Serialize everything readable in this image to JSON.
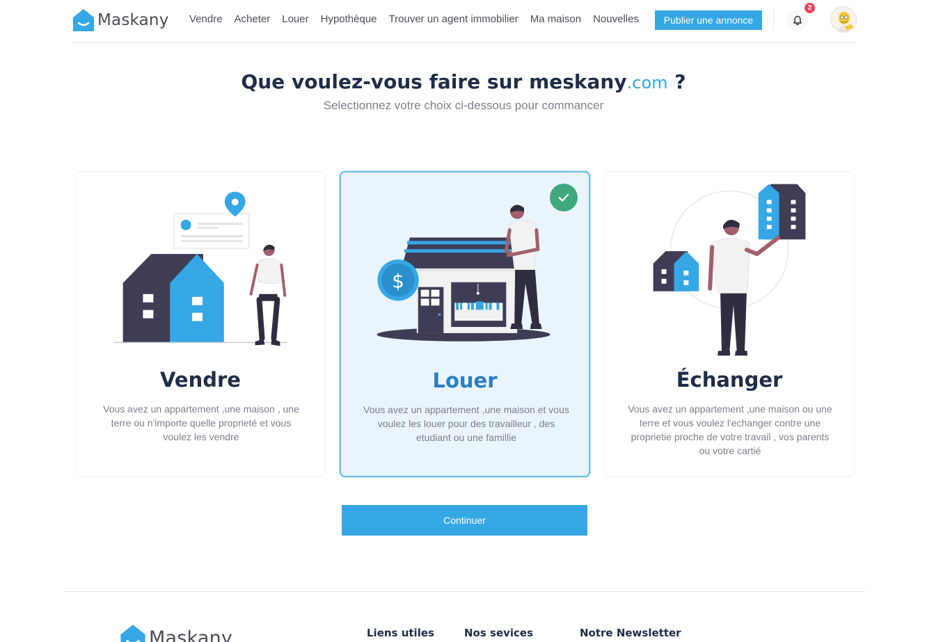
{
  "brand": {
    "name": "Maskany"
  },
  "nav": {
    "links": [
      "Vendre",
      "Acheter",
      "Louer",
      "Hypothèque",
      "Trouver un agent immobilier",
      "Ma maison",
      "Nouvelles"
    ],
    "publish_label": "Publier une annonce",
    "notification_count": "2"
  },
  "hero": {
    "title_prefix": "Que voulez-vous faire sur meskany",
    "title_domain": ".com",
    "title_suffix": " ?",
    "subtitle": "Selectionnez votre choix ci-dessous pour commancer"
  },
  "cards": [
    {
      "title": "Vendre",
      "description": "Vous avez un appartement ,une maison , une terre ou n'importe quelle proprieté et vous voulez les vendre",
      "selected": false
    },
    {
      "title": "Louer",
      "description": "Vous avez un appartement ,une maison et vous voulez les louer pour des travailleur , des etudiant ou une famillie",
      "selected": true
    },
    {
      "title": "Échanger",
      "description": "Vous avez un appartement ,une maison ou une terre et vous voulez l'echanger contre une proprietie proche de votre travail , vos parents ou votre cartié",
      "selected": false
    }
  ],
  "continue_label": "Continuer",
  "footer": {
    "brand": "Maskany",
    "columns": [
      "Liens utiles",
      "Nos sevices",
      "Notre Newsletter"
    ]
  },
  "colors": {
    "accent": "#35a7e4",
    "dark_navy": "#1f2d47",
    "house_dark": "#3f3d56",
    "success": "#3ea97b",
    "badge": "#f0425a"
  }
}
